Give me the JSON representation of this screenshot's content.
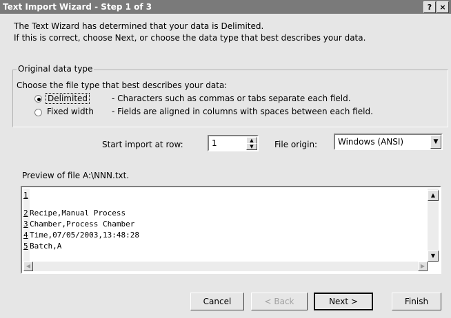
{
  "window": {
    "title": "Text Import Wizard - Step 1 of 3",
    "help_label": "?",
    "close_label": "×"
  },
  "intro": {
    "line1": "The Text Wizard has determined that your data is Delimited.",
    "line2": "If this is correct, choose Next, or choose the data type that best describes your data."
  },
  "data_type": {
    "legend": "Original data type",
    "prompt": "Choose the file type that best describes your data:",
    "options": [
      {
        "label": "Delimited",
        "description": "- Characters such as commas or tabs separate each field.",
        "selected": true
      },
      {
        "label": "Fixed width",
        "description": "- Fields are aligned in columns with spaces between each field.",
        "selected": false
      }
    ]
  },
  "start_row": {
    "label": "Start import at row:",
    "value": "1"
  },
  "file_origin": {
    "label": "File origin:",
    "value": "Windows (ANSI)"
  },
  "preview": {
    "label": "Preview of file A:\\NNN.txt.",
    "lines": [
      {
        "num": "1",
        "text": ""
      },
      {
        "num": "2",
        "text": "Recipe,Manual Process"
      },
      {
        "num": "3",
        "text": "Chamber,Process Chamber"
      },
      {
        "num": "4",
        "text": "Time,07/05/2003,13:48:28"
      },
      {
        "num": "5",
        "text": "Batch,A"
      }
    ]
  },
  "buttons": {
    "cancel": "Cancel",
    "back": "< Back",
    "next": "Next >",
    "finish": "Finish"
  }
}
